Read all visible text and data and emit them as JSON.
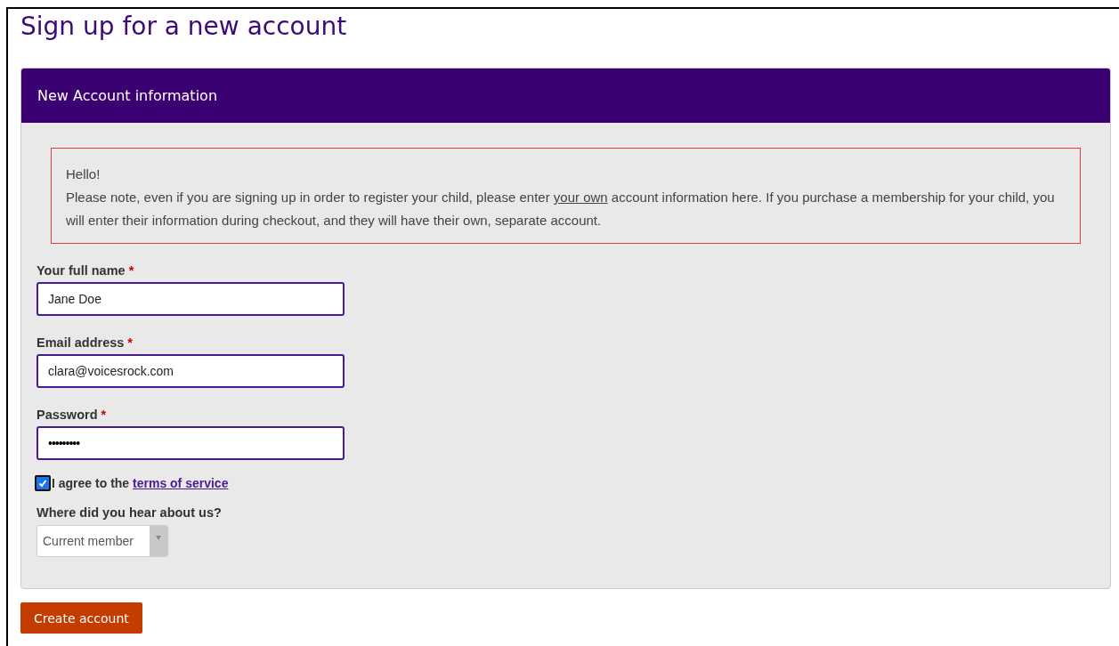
{
  "page_title": "Sign up for a new account",
  "panel": {
    "title": "New Account information"
  },
  "notice": {
    "greeting": "Hello!",
    "before": "Please note, even if you are signing up in order to register your child, please enter ",
    "underlined": "your own",
    "after": " account information here. If you purchase a membership for your child, you will enter their information during checkout, and they will have their own, separate account."
  },
  "fields": [
    {
      "label": "Your full name",
      "required_mark": "*",
      "value": "Jane Doe",
      "kind": "text"
    },
    {
      "label": "Email address",
      "required_mark": "*",
      "value": "clara@voicesrock.com",
      "kind": "text"
    },
    {
      "label": "Password",
      "required_mark": "*",
      "value": "•••••••••",
      "kind": "password"
    }
  ],
  "agree": {
    "checked": true,
    "text": "I agree to the ",
    "link": "terms of service"
  },
  "source": {
    "label": "Where did you hear about us?",
    "value": "Current member"
  },
  "submit": "Create account"
}
